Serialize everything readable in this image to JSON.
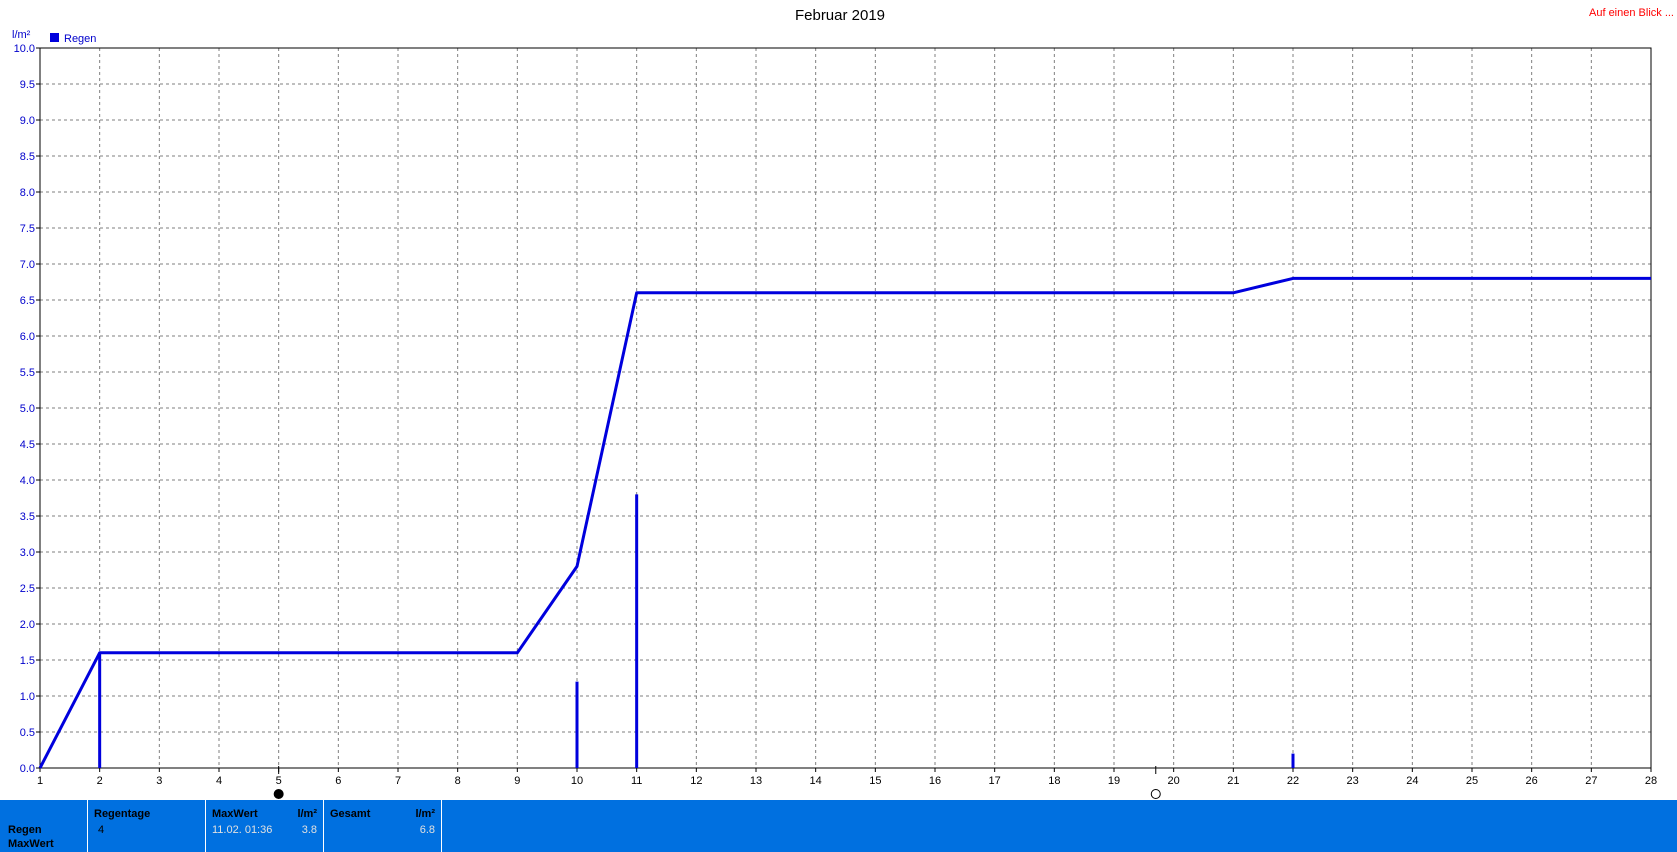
{
  "header": {
    "title": "Februar 2019",
    "link_label": "Auf einen Blick ...",
    "link_color": "#ff0000"
  },
  "chart_data": {
    "type": "line",
    "title": "Februar 2019",
    "ylabel": "l/m²",
    "xlabel": "",
    "xlim": [
      1,
      28
    ],
    "ylim": [
      0,
      10
    ],
    "x_ticks": [
      1,
      2,
      3,
      4,
      5,
      6,
      7,
      8,
      9,
      10,
      11,
      12,
      13,
      14,
      15,
      16,
      17,
      18,
      19,
      20,
      21,
      22,
      23,
      24,
      25,
      26,
      27,
      28
    ],
    "y_ticks": [
      "0.0",
      "0.5",
      "1.0",
      "1.5",
      "2.0",
      "2.5",
      "3.0",
      "3.5",
      "4.0",
      "4.5",
      "5.0",
      "5.5",
      "6.0",
      "6.5",
      "7.0",
      "7.5",
      "8.0",
      "8.5",
      "9.0",
      "9.5",
      "10.0"
    ],
    "grid": true,
    "legend_position": "top-left",
    "series": [
      {
        "name": "Regen",
        "color": "#0000dd",
        "kind": "cumulative-line",
        "x": [
          1,
          2,
          9,
          10,
          11,
          21,
          22,
          28
        ],
        "y": [
          0.0,
          1.6,
          1.6,
          2.8,
          6.6,
          6.6,
          6.8,
          6.8
        ]
      },
      {
        "name": "",
        "color": "#0000dd",
        "kind": "daily-bars",
        "x": [
          2,
          10,
          11,
          22
        ],
        "y": [
          1.6,
          1.2,
          3.8,
          0.2
        ]
      }
    ],
    "moon_markers": [
      {
        "day": 5,
        "phase": "new-moon"
      },
      {
        "day": 19.7,
        "phase": "full-moon"
      }
    ]
  },
  "summary_table": {
    "row_label": "Regen",
    "row_label2": "MaxWert",
    "regentage_label": "Regentage",
    "regentage_value": "4",
    "maxwert_label": "MaxWert",
    "maxwert_unit": "l/m²",
    "maxwert_time": "11.02.  01:36",
    "maxwert_value": "3.8",
    "gesamt_label": "Gesamt",
    "gesamt_unit": "l/m²",
    "gesamt_value": "6.8",
    "bar_color": "#0070e0"
  }
}
